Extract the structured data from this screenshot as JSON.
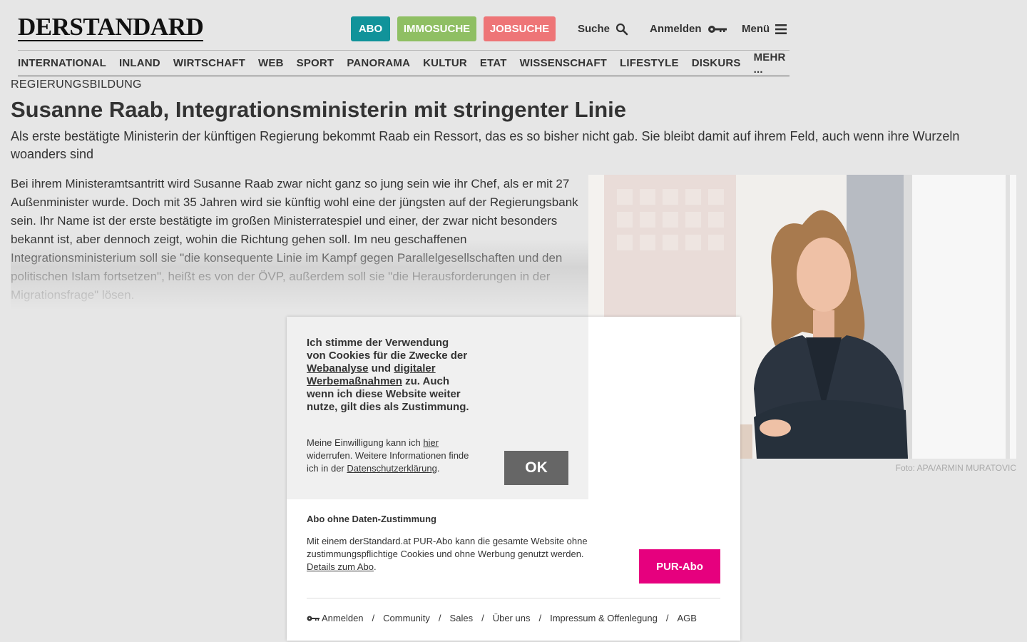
{
  "header": {
    "logo": "DERSTANDARD",
    "abo": "ABO",
    "immo": "IMMOSUCHE",
    "job": "JOBSUCHE",
    "suche": "Suche",
    "anmelden": "Anmelden",
    "menu": "Menü"
  },
  "nav": [
    "INTERNATIONAL",
    "INLAND",
    "WIRTSCHAFT",
    "WEB",
    "SPORT",
    "PANORAMA",
    "KULTUR",
    "ETAT",
    "WISSENSCHAFT",
    "LIFESTYLE",
    "DISKURS",
    "MEHR ..."
  ],
  "article": {
    "kicker": "REGIERUNGSBILDUNG",
    "headline": "Susanne Raab, Integrationsministerin mit stringenter Linie",
    "lead": "Als erste bestätigte Ministerin der künftigen Regierung bekommt Raab ein Ressort, das es so bisher nicht gab. Sie bleibt damit auf ihrem Feld, auch wenn ihre Wurzeln woanders sind",
    "body": "Bei ihrem Ministeramtsantritt wird Susanne Raab zwar nicht ganz so jung sein wie ihr Chef, als er mit 27 Außenminister wurde. Doch mit 35 Jahren wird sie künftig wohl eine der jüngsten auf der Regierungsbank sein. Ihr Name ist der erste bestätigte im großen Ministerratespiel und einer, der zwar nicht besonders bekannt ist, aber dennoch zeigt, wohin die Richtung gehen soll. Im neu geschaffenen Integrationsministerium soll sie \"die konsequente Linie im Kampf gegen Parallelgesellschaften und den politischen Islam fortsetzen\", heißt es von der ÖVP, außerdem soll sie \"die Herausforderungen in der Migrationsfrage\" lösen.",
    "photo_credit": "Foto: APA/ARMIN MURATOVIC"
  },
  "dialog": {
    "consent_p1": "Ich stimme der Verwendung von Cookies für die Zwecke der ",
    "consent_link1": "Webanalyse",
    "consent_p2": " und ",
    "consent_link2": "digitaler Werbemaßnahmen",
    "consent_p3": " zu. Auch wenn ich diese Website weiter nutze, gilt dies als Zustimmung.",
    "small_p1": "Meine Einwilligung kann ich ",
    "small_link1": "hier",
    "small_p2": " widerrufen. Weitere Informationen finde ich in der ",
    "small_link2": "Datenschutzerklärung",
    "small_p3": ".",
    "ok": "OK",
    "abo_title": "Abo ohne Daten-Zustimmung",
    "abo_text": "Mit einem derStandard.at PUR-Abo kann die gesamte Website ohne zustimmungspflichtige Cookies und ohne Werbung genutzt werden.",
    "abo_link": "Details zum Abo",
    "abo_dot": ".",
    "pur": "PUR-Abo",
    "footer": [
      "Anmelden",
      "Community",
      "Sales",
      "Über uns",
      "Impressum & Offenlegung",
      "AGB"
    ]
  }
}
